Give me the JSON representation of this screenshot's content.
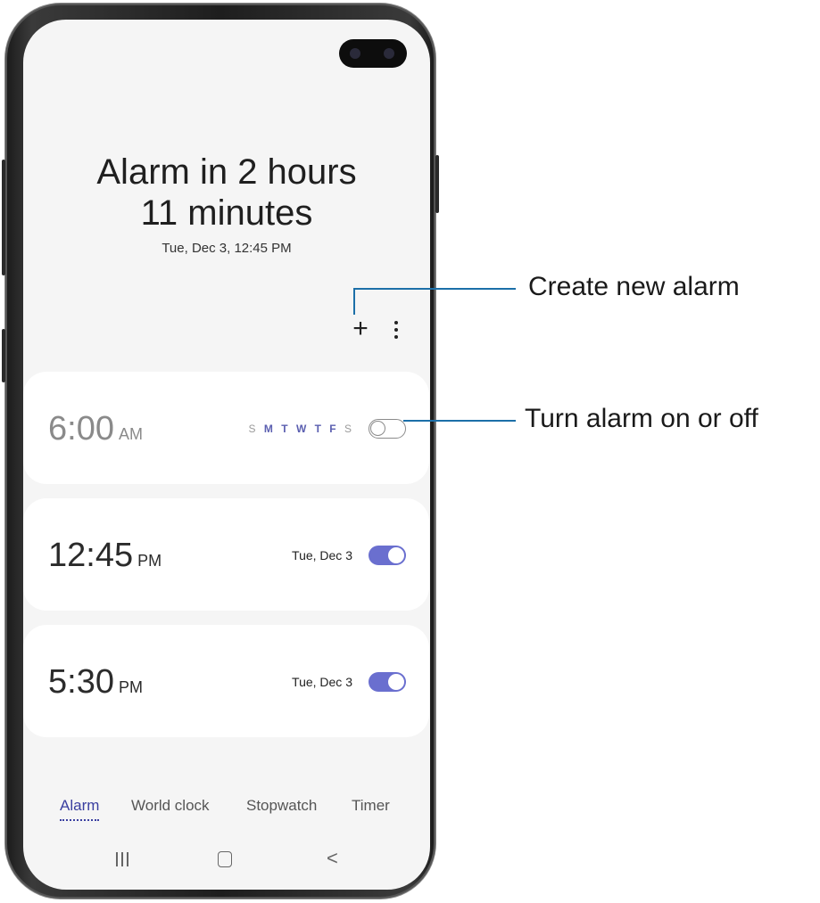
{
  "header": {
    "line1": "Alarm in 2 hours",
    "line2": "11 minutes",
    "next_alarm": "Tue, Dec 3, 12:45 PM"
  },
  "toolbar": {
    "add_label": "+"
  },
  "alarms": [
    {
      "time": "6:00",
      "ampm": "AM",
      "days": [
        "S",
        "M",
        "T",
        "W",
        "T",
        "F",
        "S"
      ],
      "enabled": false
    },
    {
      "time": "12:45",
      "ampm": "PM",
      "date": "Tue, Dec 3",
      "enabled": true
    },
    {
      "time": "5:30",
      "ampm": "PM",
      "date": "Tue, Dec 3",
      "enabled": true
    }
  ],
  "tabs": [
    {
      "label": "Alarm",
      "active": true
    },
    {
      "label": "World clock",
      "active": false
    },
    {
      "label": "Stopwatch",
      "active": false
    },
    {
      "label": "Timer",
      "active": false
    }
  ],
  "nav": {
    "back_glyph": "<"
  },
  "callouts": {
    "create": "Create new alarm",
    "toggle": "Turn alarm on or off"
  },
  "colors": {
    "accent": "#6a6fcf",
    "callout_line": "#1c6fa8"
  }
}
